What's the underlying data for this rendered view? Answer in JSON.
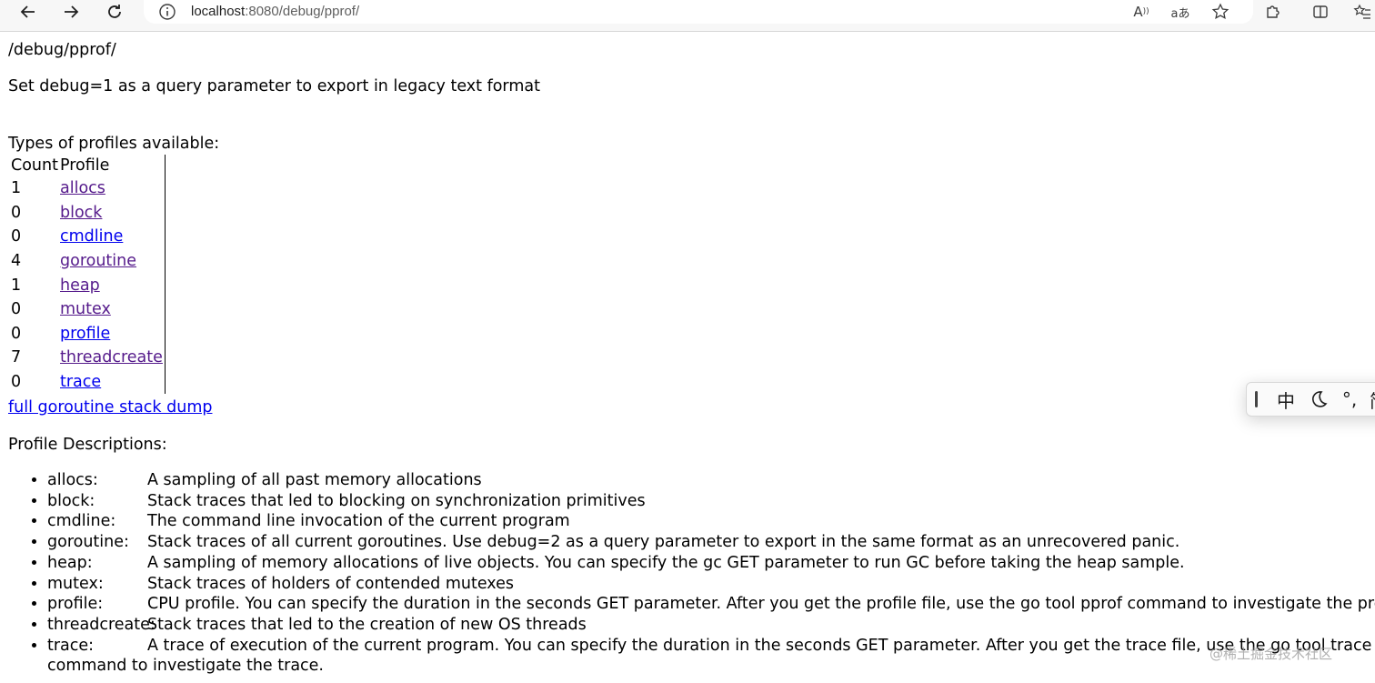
{
  "browser": {
    "url_host": "localhost",
    "url_rest": ":8080/debug/pprof/",
    "icons": [
      "back-arrow-icon",
      "forward-arrow-icon",
      "refresh-icon",
      "info-icon",
      "read-aloud-icon",
      "translate-icon",
      "favorite-star-icon",
      "extensions-icon",
      "split-screen-icon",
      "favorites-list-icon"
    ],
    "read_aloud_glyph": "A",
    "translate_glyph": "aあ"
  },
  "page": {
    "title": "/debug/pprof/",
    "intro": "Set debug=1 as a query parameter to export in legacy text format",
    "types_heading": "Types of profiles available:",
    "table": {
      "headers": [
        "Count",
        "Profile"
      ],
      "rows": [
        {
          "count": "1",
          "profile": "allocs",
          "visited": true
        },
        {
          "count": "0",
          "profile": "block",
          "visited": true
        },
        {
          "count": "0",
          "profile": "cmdline",
          "visited": false
        },
        {
          "count": "4",
          "profile": "goroutine",
          "visited": true
        },
        {
          "count": "1",
          "profile": "heap",
          "visited": true
        },
        {
          "count": "0",
          "profile": "mutex",
          "visited": true
        },
        {
          "count": "0",
          "profile": "profile",
          "visited": false
        },
        {
          "count": "7",
          "profile": "threadcreate",
          "visited": true
        },
        {
          "count": "0",
          "profile": "trace",
          "visited": false
        }
      ]
    },
    "dump_link": "full goroutine stack dump",
    "descriptions_heading": "Profile Descriptions:",
    "descriptions": [
      {
        "name": "allocs:",
        "text": "A sampling of all past memory allocations"
      },
      {
        "name": "block:",
        "text": "Stack traces that led to blocking on synchronization primitives"
      },
      {
        "name": "cmdline:",
        "text": "The command line invocation of the current program"
      },
      {
        "name": "goroutine:",
        "text": "Stack traces of all current goroutines. Use debug=2 as a query parameter to export in the same format as an unrecovered panic."
      },
      {
        "name": "heap:",
        "text": "A sampling of memory allocations of live objects. You can specify the gc GET parameter to run GC before taking the heap sample."
      },
      {
        "name": "mutex:",
        "text": "Stack traces of holders of contended mutexes"
      },
      {
        "name": "profile:",
        "text": "CPU profile. You can specify the duration in the seconds GET parameter. After you get the profile file, use the go tool pprof command to investigate the profile."
      },
      {
        "name": "threadcreate:",
        "text": "Stack traces that led to the creation of new OS threads"
      },
      {
        "name": "trace:",
        "text": "A trace of execution of the current program. You can specify the duration in the seconds GET parameter. After you get the trace file, use the go tool trace command to investigate the trace."
      }
    ]
  },
  "ime": {
    "items": [
      "中",
      "°,",
      "简"
    ],
    "icons": [
      "ime-handle-icon",
      "moon-icon"
    ]
  },
  "watermark": "@稀土掘金技术社区",
  "colors": {
    "link": "#0000ee",
    "visited_link": "#551a8b",
    "chrome_bg": "#f7f7f7"
  }
}
